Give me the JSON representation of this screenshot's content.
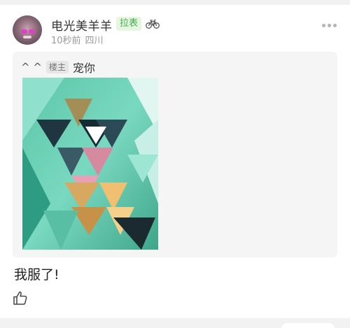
{
  "post": {
    "username": "电光美羊羊",
    "badge": "拉表",
    "time": "10秒前",
    "location": "四川",
    "content": "我服了!"
  },
  "quote": {
    "user": "^ ^",
    "tag": "楼主",
    "text": "宠你"
  },
  "icons": {
    "vehicle": "bicycle-icon",
    "more": "more-dots-icon",
    "like": "thumbs-up-icon"
  },
  "colors": {
    "badge_text": "#3fb24a",
    "badge_bg": "#e6f6e0",
    "meta_text": "#9a9a9a",
    "quote_bg": "#f5f5f5"
  }
}
